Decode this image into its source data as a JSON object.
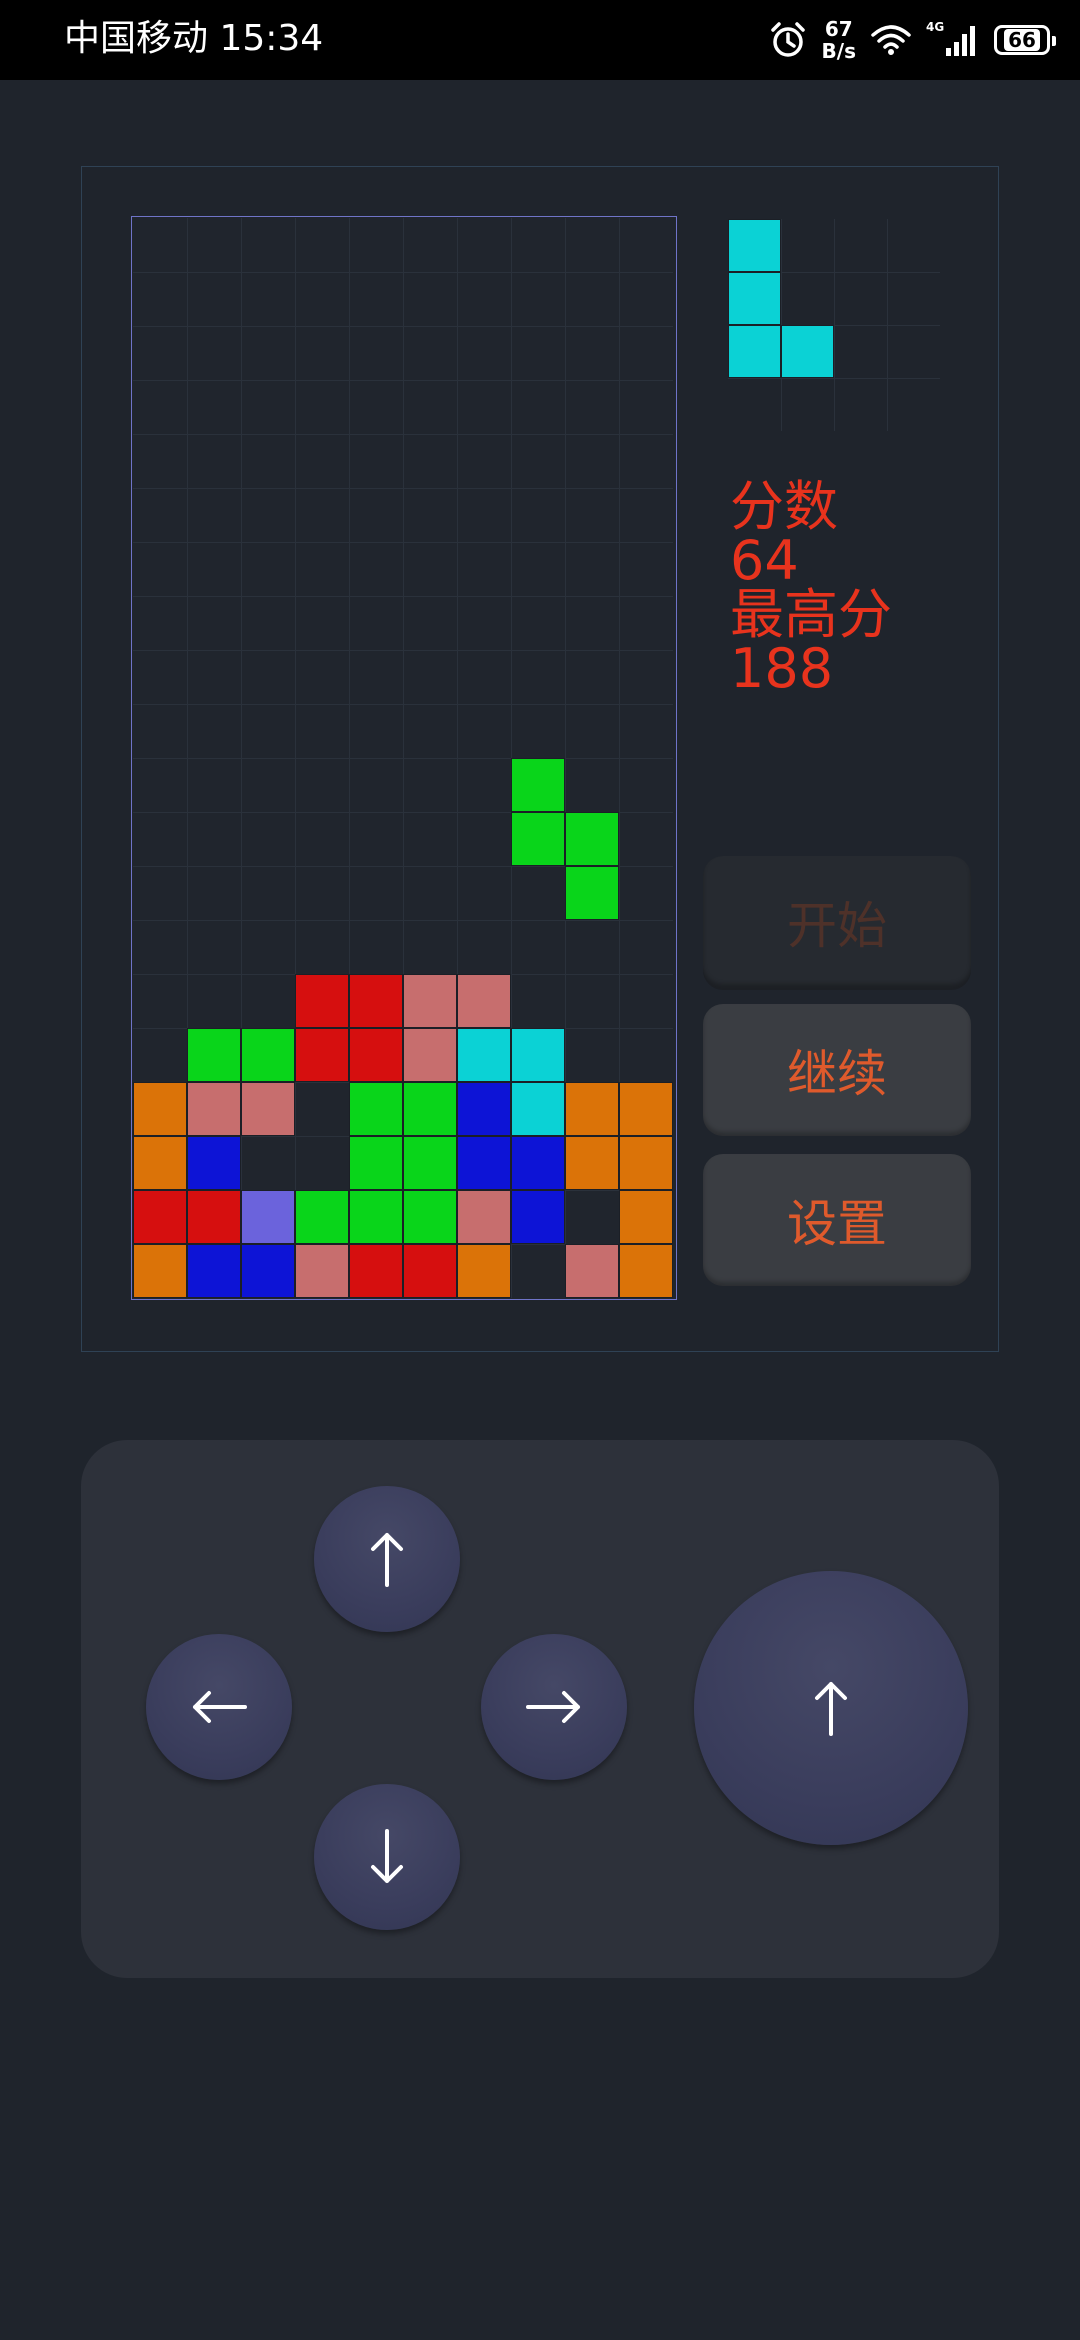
{
  "status_bar": {
    "carrier_time": "中国移动 15:34",
    "net_speed_value": "67",
    "net_speed_unit": "B/s",
    "network_type": "4G",
    "battery": "66"
  },
  "colors": {
    "O": "#db7308",
    "B": "#0d14d6",
    "R": "#d60f0f",
    "G": "#09d51a",
    "P": "#c76e6e",
    "C": "#0bd2d5",
    "L": "#6b63dc",
    "accent_text": "#e8331d"
  },
  "board": {
    "cols": 10,
    "rows": 20,
    "rows_layout": [
      "..........",
      "..........",
      "..........",
      "..........",
      "..........",
      "..........",
      "..........",
      "..........",
      "..........",
      "..........",
      ".......G..",
      ".......GG.",
      "........G.",
      "..........",
      "...RRPP...",
      ".GGRRPCC..",
      "OPP.GGBCOO",
      "OB..GGBBOO",
      "RRLGGGPB.O",
      "OBBPRRO.PO"
    ]
  },
  "next_piece": {
    "cols": 4,
    "rows": 4,
    "rows_layout": [
      "C...",
      "C...",
      "CC..",
      "...."
    ]
  },
  "score": {
    "label": "分数",
    "value": "64",
    "high_label": "最高分",
    "high_value": "188"
  },
  "buttons": {
    "start": "开始",
    "continue": "继续",
    "settings": "设置"
  },
  "controls": {
    "up_icon": "arrow-up-icon",
    "left_icon": "arrow-left-icon",
    "right_icon": "arrow-right-icon",
    "down_icon": "arrow-down-icon",
    "rotate_icon": "arrow-up-icon"
  }
}
